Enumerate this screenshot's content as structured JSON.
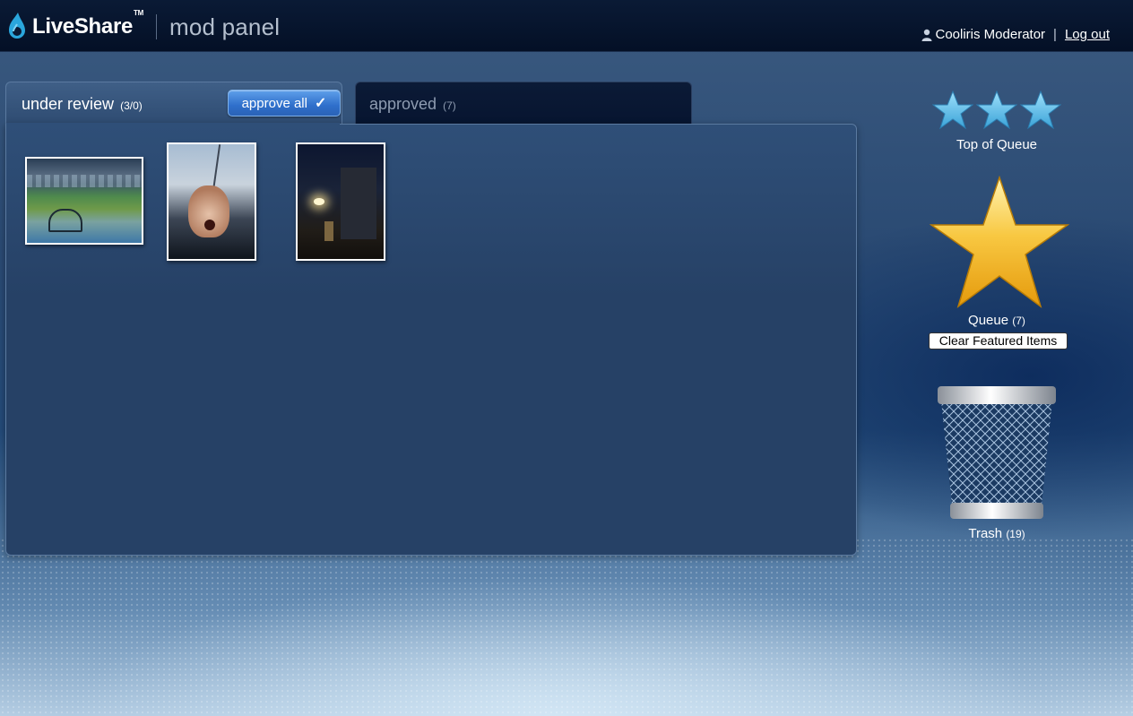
{
  "header": {
    "brand": "LiveShare",
    "trademark": "TM",
    "section": "mod panel",
    "user_name": "Cooliris Moderator",
    "separator": "|",
    "logout_label": "Log out"
  },
  "tabs": {
    "review": {
      "label": "under review",
      "count": "(3/0)",
      "approve_all_label": "approve all"
    },
    "approved": {
      "label": "approved",
      "count": "(7)"
    }
  },
  "thumbnails": [
    {
      "icon": "ballpark-photo"
    },
    {
      "icon": "face-photo"
    },
    {
      "icon": "night-street-photo"
    }
  ],
  "sidebar": {
    "top_of_queue_label": "Top of Queue",
    "queue_label": "Queue",
    "queue_count": "(7)",
    "clear_featured_label": "Clear Featured Items",
    "trash_label": "Trash",
    "trash_count": "(19)"
  },
  "colors": {
    "header_bg": "#041026",
    "panel_bg": "#264166",
    "approve_button": "#2f6fcb",
    "small_star": "#5fb8e6",
    "big_star": "#f2b41c"
  }
}
